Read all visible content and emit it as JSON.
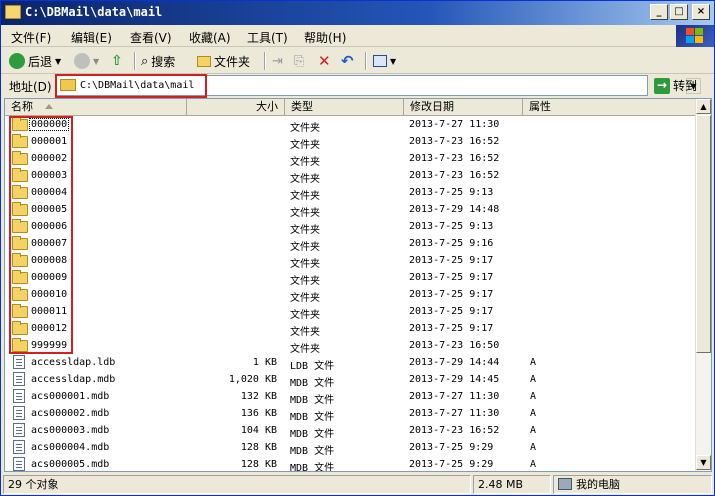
{
  "window": {
    "title": "C:\\DBMail\\data\\mail"
  },
  "menu": [
    "文件(F)",
    "编辑(E)",
    "查看(V)",
    "收藏(A)",
    "工具(T)",
    "帮助(H)"
  ],
  "toolbar": {
    "back": "后退",
    "search": "搜索",
    "folders": "文件夹"
  },
  "address": {
    "label": "地址(D)",
    "path": "C:\\DBMail\\data\\mail",
    "go": "转到"
  },
  "columns": {
    "name": "名称",
    "size": "大小",
    "type": "类型",
    "modified": "修改日期",
    "attributes": "属性"
  },
  "folders": [
    {
      "name": "000000",
      "type": "文件夹",
      "modified": "2013-7-27 11:30"
    },
    {
      "name": "000001",
      "type": "文件夹",
      "modified": "2013-7-23 16:52"
    },
    {
      "name": "000002",
      "type": "文件夹",
      "modified": "2013-7-23 16:52"
    },
    {
      "name": "000003",
      "type": "文件夹",
      "modified": "2013-7-23 16:52"
    },
    {
      "name": "000004",
      "type": "文件夹",
      "modified": "2013-7-25 9:13"
    },
    {
      "name": "000005",
      "type": "文件夹",
      "modified": "2013-7-29 14:48"
    },
    {
      "name": "000006",
      "type": "文件夹",
      "modified": "2013-7-25 9:13"
    },
    {
      "name": "000007",
      "type": "文件夹",
      "modified": "2013-7-25 9:16"
    },
    {
      "name": "000008",
      "type": "文件夹",
      "modified": "2013-7-25 9:17"
    },
    {
      "name": "000009",
      "type": "文件夹",
      "modified": "2013-7-25 9:17"
    },
    {
      "name": "000010",
      "type": "文件夹",
      "modified": "2013-7-25 9:17"
    },
    {
      "name": "000011",
      "type": "文件夹",
      "modified": "2013-7-25 9:17"
    },
    {
      "name": "000012",
      "type": "文件夹",
      "modified": "2013-7-25 9:17"
    },
    {
      "name": "999999",
      "type": "文件夹",
      "modified": "2013-7-23 16:50"
    }
  ],
  "files": [
    {
      "name": "accessldap.ldb",
      "size": "1 KB",
      "type": "LDB 文件",
      "modified": "2013-7-29 14:44",
      "attr": "A"
    },
    {
      "name": "accessldap.mdb",
      "size": "1,020 KB",
      "type": "MDB 文件",
      "modified": "2013-7-29 14:45",
      "attr": "A"
    },
    {
      "name": "acs000001.mdb",
      "size": "132 KB",
      "type": "MDB 文件",
      "modified": "2013-7-27 11:30",
      "attr": "A"
    },
    {
      "name": "acs000002.mdb",
      "size": "136 KB",
      "type": "MDB 文件",
      "modified": "2013-7-27 11:30",
      "attr": "A"
    },
    {
      "name": "acs000003.mdb",
      "size": "104 KB",
      "type": "MDB 文件",
      "modified": "2013-7-23 16:52",
      "attr": "A"
    },
    {
      "name": "acs000004.mdb",
      "size": "128 KB",
      "type": "MDB 文件",
      "modified": "2013-7-25 9:29",
      "attr": "A"
    },
    {
      "name": "acs000005.mdb",
      "size": "128 KB",
      "type": "MDB 文件",
      "modified": "2013-7-25 9:29",
      "attr": "A"
    }
  ],
  "status": {
    "count": "29 个对象",
    "size": "2.48 MB",
    "location": "我的电脑"
  },
  "colors": {
    "title_bar": "#0a246a",
    "highlight": "#d22020",
    "chrome": "#ece9d8"
  }
}
